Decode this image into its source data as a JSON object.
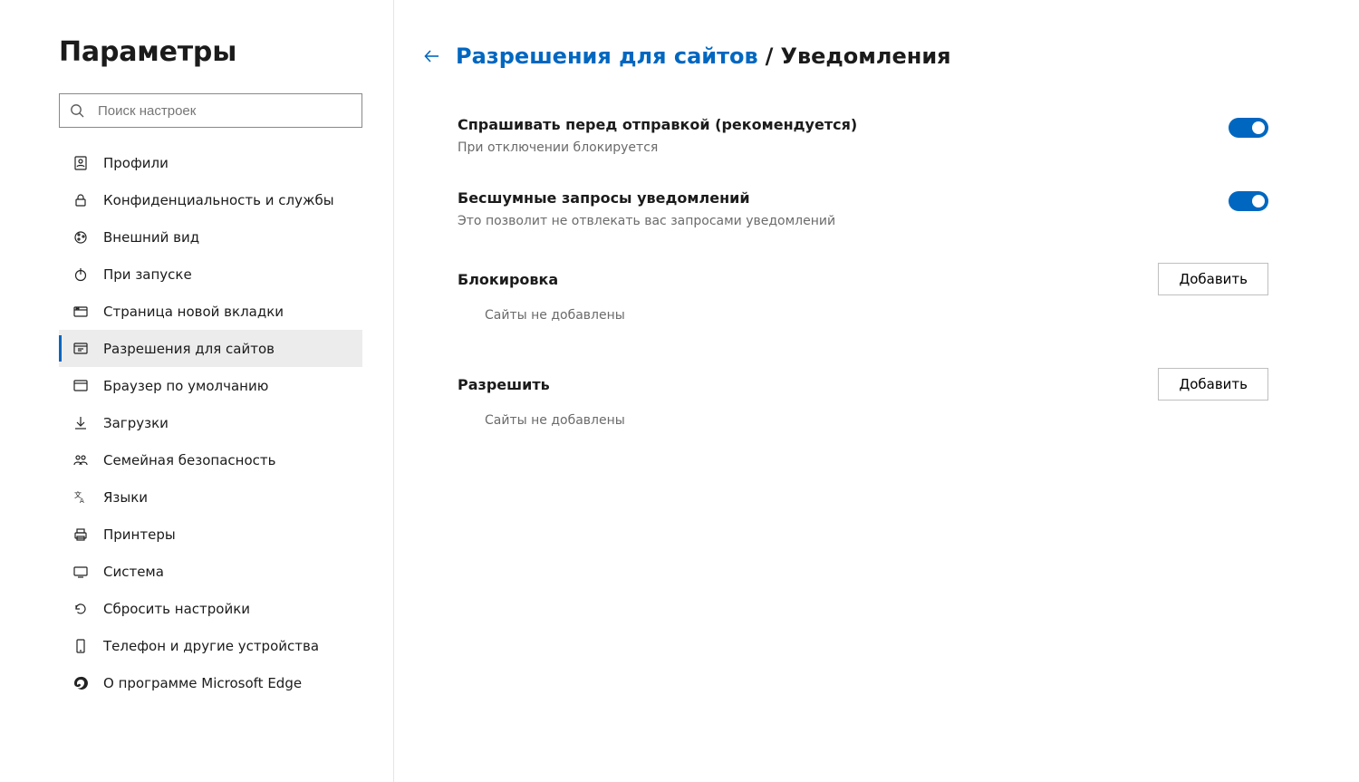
{
  "sidebar": {
    "title": "Параметры",
    "search_placeholder": "Поиск настроек",
    "items": [
      {
        "label": "Профили",
        "icon": "profile-icon"
      },
      {
        "label": "Конфиденциальность и службы",
        "icon": "lock-icon"
      },
      {
        "label": "Внешний вид",
        "icon": "appearance-icon"
      },
      {
        "label": "При запуске",
        "icon": "power-icon"
      },
      {
        "label": "Страница новой вкладки",
        "icon": "newtab-icon"
      },
      {
        "label": "Разрешения для сайтов",
        "icon": "permissions-icon",
        "selected": true
      },
      {
        "label": "Браузер по умолчанию",
        "icon": "default-browser-icon"
      },
      {
        "label": "Загрузки",
        "icon": "download-icon"
      },
      {
        "label": "Семейная безопасность",
        "icon": "family-icon"
      },
      {
        "label": "Языки",
        "icon": "language-icon"
      },
      {
        "label": "Принтеры",
        "icon": "printer-icon"
      },
      {
        "label": "Система",
        "icon": "system-icon"
      },
      {
        "label": "Сбросить настройки",
        "icon": "reset-icon"
      },
      {
        "label": "Телефон и другие устройства",
        "icon": "phone-icon"
      },
      {
        "label": "О программе Microsoft Edge",
        "icon": "edge-icon"
      }
    ]
  },
  "breadcrumb": {
    "parent": "Разрешения для сайтов",
    "separator": "/",
    "current": "Уведомления"
  },
  "settings": {
    "ask": {
      "title": "Спрашивать перед отправкой (рекомендуется)",
      "desc": "При отключении блокируется",
      "on": true
    },
    "quiet": {
      "title": "Бесшумные запросы уведомлений",
      "desc": "Это позволит не отвлекать вас запросами уведомлений",
      "on": true
    }
  },
  "sections": {
    "block": {
      "title": "Блокировка",
      "add": "Добавить",
      "empty": "Сайты не добавлены"
    },
    "allow": {
      "title": "Разрешить",
      "add": "Добавить",
      "empty": "Сайты не добавлены"
    }
  }
}
